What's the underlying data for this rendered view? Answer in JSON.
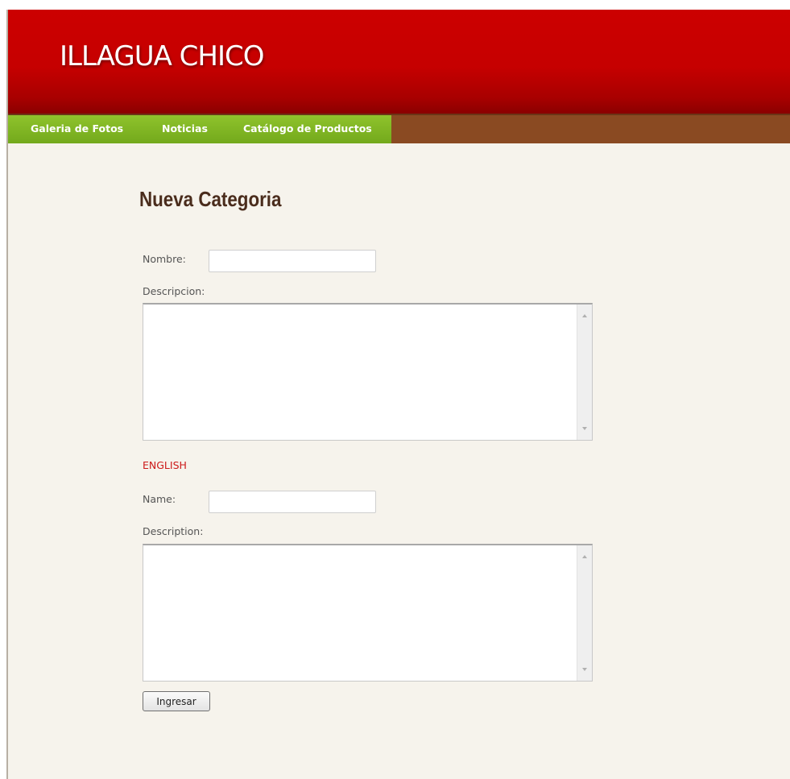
{
  "header": {
    "site_title": "ILLAGUA CHICO"
  },
  "nav": {
    "items": [
      {
        "label": "Galeria de Fotos"
      },
      {
        "label": "Noticias"
      },
      {
        "label": "Catálogo de Productos"
      }
    ]
  },
  "form": {
    "heading": "Nueva Categoria",
    "nombre_label": "Nombre:",
    "nombre_value": "",
    "descripcion_label": "Descripcion:",
    "descripcion_value": "",
    "english_heading": "ENGLISH",
    "name_label": "Name:",
    "name_value": "",
    "description_label": "Description:",
    "description_value": "",
    "submit_label": "Ingresar"
  },
  "colors": {
    "header_red": "#cc0000",
    "nav_green": "#7fb524",
    "nav_brown": "#8a4a22",
    "heading_brown": "#4a2c1c",
    "english_red": "#cc1a1a",
    "page_bg": "#f6f3ec"
  },
  "icons": [
    "scroll-up-arrow-icon",
    "scroll-down-arrow-icon"
  ]
}
